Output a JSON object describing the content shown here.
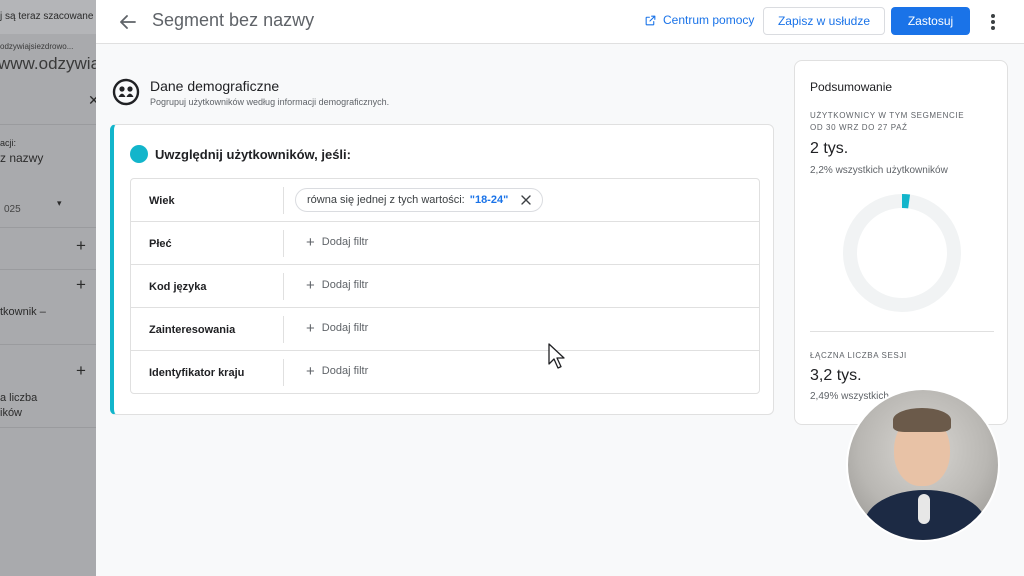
{
  "background_panel": {
    "texts": [
      "j są teraz szacowane",
      "odzywiajsiezdrowo...",
      "www.odzywia",
      "acji:",
      "z nazwy",
      "025",
      "tkownik –",
      "a liczba",
      "ików"
    ]
  },
  "header": {
    "title": "Segment bez nazwy",
    "help_label": "Centrum pomocy",
    "save_label": "Zapisz w usłudze",
    "apply_label": "Zastosuj"
  },
  "section": {
    "title": "Dane demograficzne",
    "subtitle": "Pogrupuj użytkowników według informacji demograficznych."
  },
  "card": {
    "title": "Uwzględnij użytkowników, jeśli:",
    "rows": [
      {
        "label": "Wiek",
        "chip_text": "równa się jednej z tych wartości:",
        "chip_value": "\"18-24\""
      },
      {
        "label": "Płeć",
        "action": "Dodaj filtr"
      },
      {
        "label": "Kod języka",
        "action": "Dodaj filtr"
      },
      {
        "label": "Zainteresowania",
        "action": "Dodaj filtr"
      },
      {
        "label": "Identyfikator kraju",
        "action": "Dodaj filtr"
      }
    ]
  },
  "summary": {
    "title": "Podsumowanie",
    "users_label": "Użytkownicy w tym segmencie od 30 wrz do 27 paź",
    "users_value": "2 tys.",
    "users_pct": "2,2% wszystkich użytkowników",
    "users_fraction": 0.022,
    "sessions_label": "Łączna liczba sesji",
    "sessions_value": "3,2 tys.",
    "sessions_pct": "2,49% wszystkich"
  },
  "colors": {
    "accent": "#1a73e8",
    "segment": "#12b5cb",
    "donut_track": "#f1f3f4"
  },
  "icons": {
    "back": "arrow-left-icon",
    "help": "open-in-new-icon",
    "more": "more-vert-icon",
    "section": "demographics-icon",
    "remove": "close-icon",
    "add": "plus-icon"
  }
}
